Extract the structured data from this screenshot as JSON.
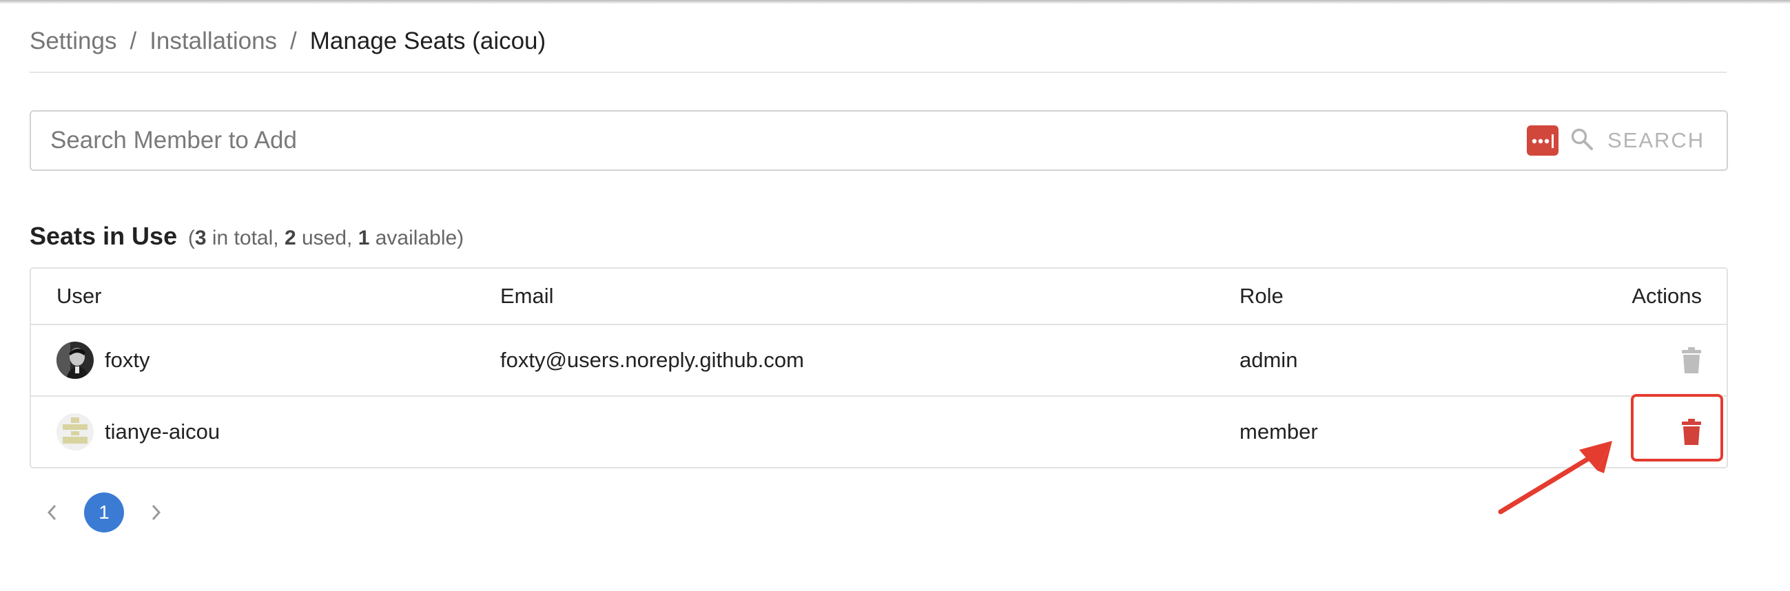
{
  "breadcrumb": {
    "items": [
      "Settings",
      "Installations"
    ],
    "separator": "/",
    "current": "Manage Seats (aicou)"
  },
  "search": {
    "placeholder": "Search Member to Add",
    "value": "",
    "button_label": "SEARCH"
  },
  "seats": {
    "title": "Seats in Use",
    "open_paren": "(",
    "total": "3",
    "total_label": "in total,",
    "used": "2",
    "used_label": "used,",
    "available": "1",
    "available_label": "available)"
  },
  "table": {
    "columns": {
      "user": "User",
      "email": "Email",
      "role": "Role",
      "actions": "Actions"
    },
    "rows": [
      {
        "user": "foxty",
        "email": "foxty@users.noreply.github.com",
        "role": "admin"
      },
      {
        "user": "tianye-aicou",
        "email": "",
        "role": "member"
      }
    ]
  },
  "pagination": {
    "current_page": "1"
  },
  "colors": {
    "accent_blue": "#3b7bd4",
    "danger_red": "#d2413a",
    "annotation_red": "#e43c2f",
    "disabled_gray": "#bdbdbd"
  },
  "icons": [
    "password-manager-icon",
    "search-icon",
    "trash-icon",
    "chevron-left-icon",
    "chevron-right-icon"
  ]
}
